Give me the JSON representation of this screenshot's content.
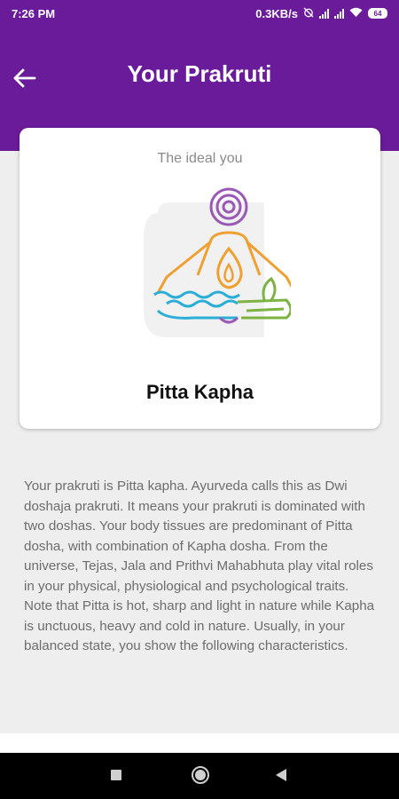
{
  "status_bar": {
    "time": "7:26 PM",
    "network_speed": "0.3KB/s",
    "battery_level": "64"
  },
  "header": {
    "title": "Your Prakruti",
    "back_icon": "arrow-left-icon"
  },
  "card": {
    "subtitle": "The ideal you",
    "prakruti_type": "Pitta Kapha",
    "illustration": "dosha-meditation-logo"
  },
  "description": "Your prakruti is Pitta kapha. Ayurveda calls this as Dwi doshaja prakruti. It means your prakruti is dominated with two doshas. Your body tissues are predominant of Pitta dosha, with combination of Kapha dosha. From the universe, Tejas, Jala and Prithvi Mahabhuta play vital roles in your physical, physiological and psychological traits. Note that Pitta is hot, sharp and light in nature while Kapha is unctuous, heavy and cold in nature. Usually, in your balanced state, you show the following characteristics.",
  "colors": {
    "primary": "#6a1b9a",
    "background": "#eeeeee",
    "vata": "#9b59b6",
    "pitta": "#f0a030",
    "kapha_water": "#2aaed8",
    "kapha_earth": "#7cb342"
  },
  "nav_bar": {
    "recents_icon": "square-icon",
    "home_icon": "circle-icon",
    "back_icon": "triangle-back-icon"
  }
}
